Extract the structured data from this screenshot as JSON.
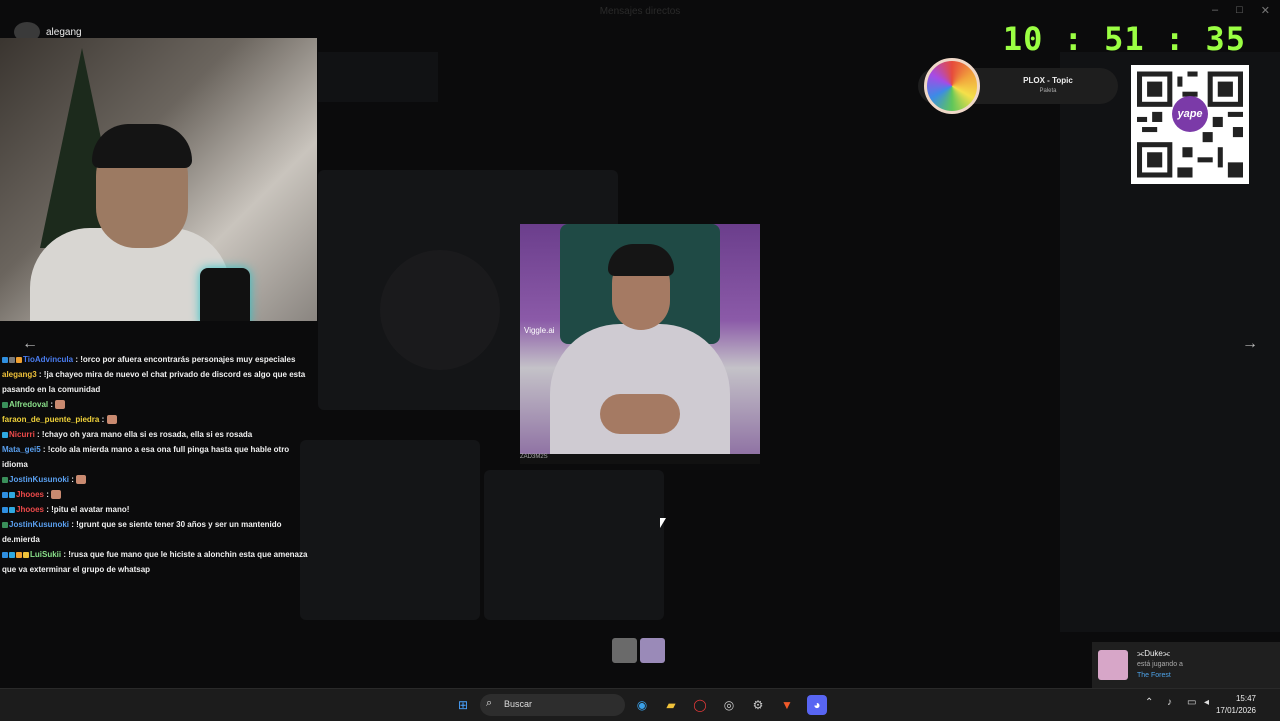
{
  "window": {
    "title": "Mensajes directos",
    "controls": [
      "–",
      "□",
      "✕"
    ]
  },
  "stream": {
    "cam_username": "alegang",
    "clock": {
      "hours": "10",
      "minutes": "51",
      "seconds": "35",
      "separator": ":"
    },
    "now_playing": {
      "title": "PLOX - Topic",
      "subtitle": "Paleta"
    },
    "qr_label": "yape",
    "popup": {
      "watermark": "Viggle.ai",
      "footer": "ZAD3M2S"
    }
  },
  "chat": [
    {
      "user": "TioAdvincula",
      "user_color": "#4a7df0",
      "text": ": !orco por afuera encontrarás personajes muy especiales",
      "badges": [
        "#2f8fe0",
        "#7a7a7a",
        "#f0a030"
      ]
    },
    {
      "user": "alegang3",
      "user_color": "#f0c23a",
      "text": ": !ja chayeo mira de nuevo el chat privado de discord es algo que esta pasando en la comunidad",
      "badges": []
    },
    {
      "user": "Alfredoval",
      "user_color": "#8ae08a",
      "text": ":",
      "badges": [
        "#3a8f5a"
      ],
      "emote": true
    },
    {
      "user": "faraon_de_puente_piedra",
      "user_color": "#f0d23a",
      "text": ":",
      "badges": [],
      "emote": true
    },
    {
      "user": "Nicurri",
      "user_color": "#ee4a4a",
      "text": ": !chayo oh yara mano ella si es rosada, ella si es rosada",
      "badges": [
        "#2fa8e0"
      ]
    },
    {
      "user": "Mata_gei5",
      "user_color": "#5aa0f0",
      "text": ": !colo ala mierda mano a esa ona full pinga hasta que hable otro idioma",
      "badges": []
    },
    {
      "user": "JostinKusunoki",
      "user_color": "#5aa0f0",
      "text": ":",
      "badges": [
        "#3a8f5a"
      ],
      "emote": true
    },
    {
      "user": "Jhooes",
      "user_color": "#ee4a4a",
      "text": ":",
      "badges": [
        "#2f8fe0",
        "#2fa8e0"
      ],
      "emote": true
    },
    {
      "user": "Jhooes",
      "user_color": "#ee4a4a",
      "text": ": !pitu el avatar mano!",
      "badges": [
        "#2f8fe0",
        "#2fa8e0"
      ]
    },
    {
      "user": "JostinKusunoki",
      "user_color": "#5aa0f0",
      "text": ": !grunt que se siente tener 30 años y ser un mantenido de.mierda",
      "badges": [
        "#3a8f5a"
      ]
    },
    {
      "user": "LuiSukii",
      "user_color": "#8ae08a",
      "text": ": !rusa que fue mano que le hiciste a alonchin esta que amenaza que va exterminar el grupo de whatsap",
      "badges": [
        "#2f8fe0",
        "#2fa8e0",
        "#f0a030",
        "#f0c23a"
      ]
    }
  ],
  "notification": {
    "name": "⫘Duke⫘",
    "line": "está jugando a",
    "game": "The Forest"
  },
  "taskbar": {
    "search_placeholder": "Buscar",
    "time": "15:47",
    "date": "17/01/2026"
  },
  "colors": {
    "clock": "#9bff43",
    "taskbar": "#1c1c1c"
  }
}
